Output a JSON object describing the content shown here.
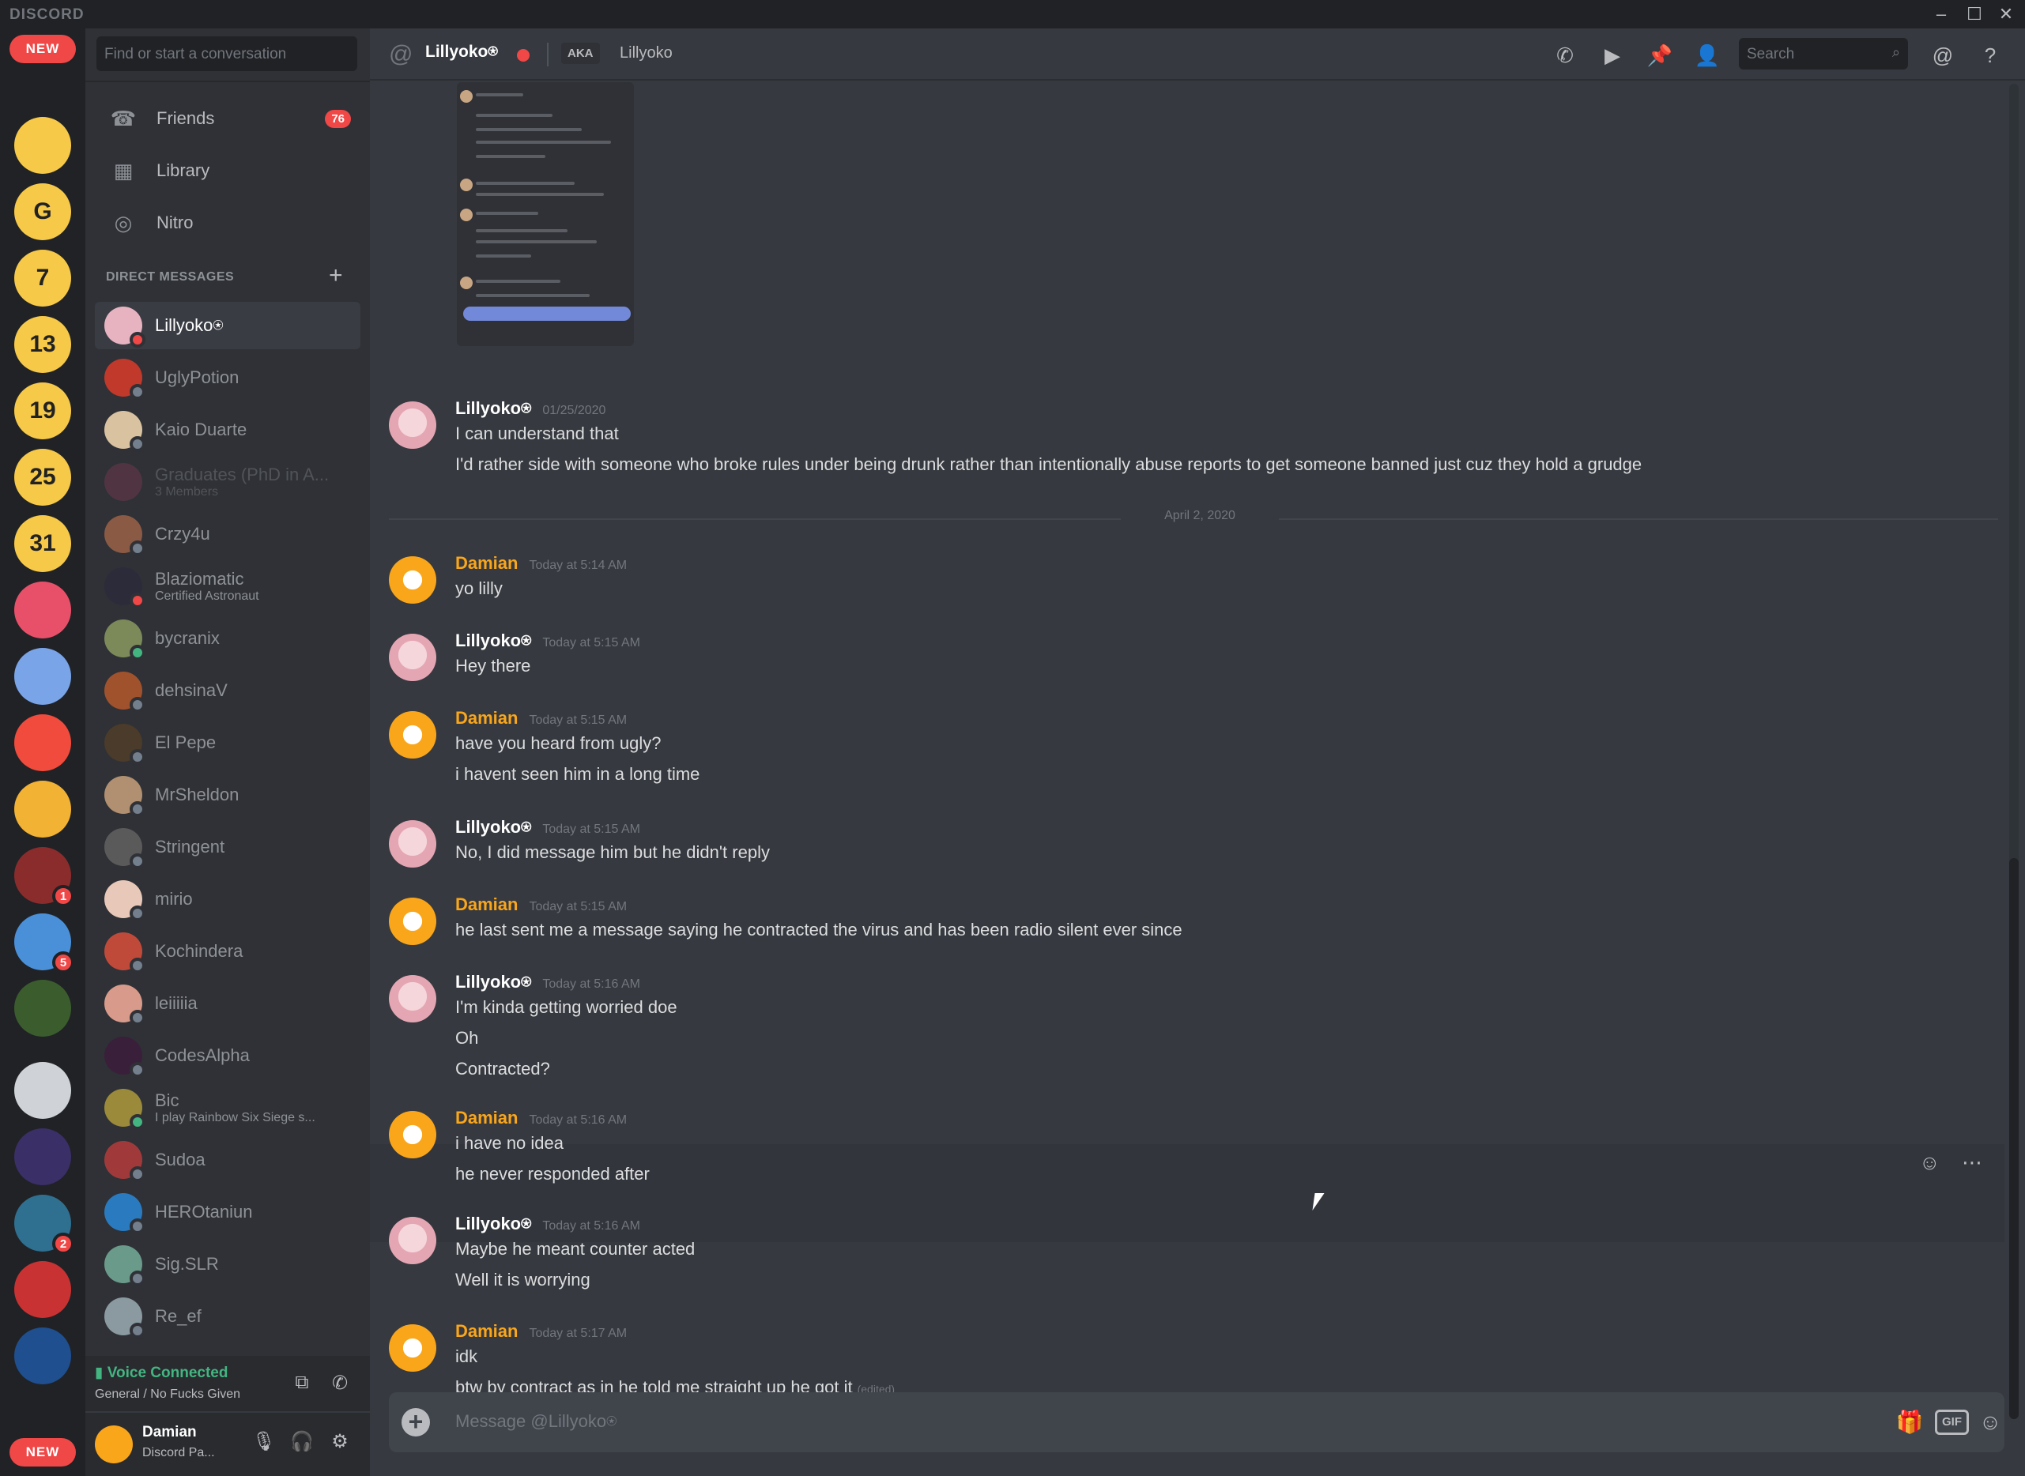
{
  "app": {
    "brand": "DISCORD",
    "window_controls": [
      "–",
      "☐",
      "✕"
    ]
  },
  "rail": {
    "new_top": "NEW",
    "new_bottom": "NEW",
    "servers": [
      {
        "label": "",
        "bg": "#f7c948",
        "badge": ""
      },
      {
        "label": "G",
        "bg": "#f7c948",
        "badge": ""
      },
      {
        "label": "7",
        "bg": "#f7c948",
        "badge": ""
      },
      {
        "label": "13",
        "bg": "#f7c948",
        "badge": ""
      },
      {
        "label": "19",
        "bg": "#f7c948",
        "badge": ""
      },
      {
        "label": "25",
        "bg": "#f7c948",
        "badge": ""
      },
      {
        "label": "31",
        "bg": "#f7c948",
        "badge": ""
      },
      {
        "label": "",
        "bg": "#e8506a",
        "badge": ""
      },
      {
        "label": "",
        "bg": "#7aa4e8",
        "badge": ""
      },
      {
        "label": "",
        "bg": "#f04b3c",
        "badge": ""
      },
      {
        "label": "",
        "bg": "#f2b233",
        "badge": ""
      },
      {
        "label": "",
        "bg": "#8a2c2c",
        "badge": "1"
      },
      {
        "label": "",
        "bg": "#4a90d9",
        "badge": "5"
      },
      {
        "label": "",
        "bg": "#3b5d2e",
        "badge": ""
      },
      {
        "label": "",
        "bg": "#cfd2d6",
        "badge": ""
      },
      {
        "label": "",
        "bg": "#3a2f66",
        "badge": ""
      },
      {
        "label": "",
        "bg": "#2f6f8f",
        "badge": "2"
      },
      {
        "label": "",
        "bg": "#c83232",
        "badge": ""
      },
      {
        "label": "",
        "bg": "#1f4f8f",
        "badge": ""
      }
    ]
  },
  "dm_panel": {
    "search_placeholder": "Find or start a conversation",
    "nav": [
      {
        "label": "Friends",
        "icon": "friends-icon",
        "count": "76"
      },
      {
        "label": "Library",
        "icon": "library-icon",
        "count": ""
      },
      {
        "label": "Nitro",
        "icon": "nitro-icon",
        "count": ""
      }
    ],
    "heading": "DIRECT MESSAGES",
    "add_symbol": "+",
    "dms": [
      {
        "name": "Lillyoko⍟",
        "sub": "",
        "status": "dnd",
        "color": "#e7b3c0",
        "active": true
      },
      {
        "name": "UglyPotion",
        "sub": "",
        "status": "mobile",
        "color": "#c0392b"
      },
      {
        "name": "Kaio Duarte",
        "sub": "",
        "status": "offline",
        "color": "#d9c2a0"
      },
      {
        "name": "Graduates (PhD in A...",
        "sub": "3 Members",
        "status": "",
        "color": "#8e3a59",
        "faded": true
      },
      {
        "name": "Crzy4u",
        "sub": "",
        "status": "offline",
        "color": "#8a5a44"
      },
      {
        "name": "Blaziomatic",
        "sub": "Certified Astronaut",
        "status": "dnd",
        "color": "#2b2b3a"
      },
      {
        "name": "bycranix",
        "sub": "",
        "status": "on",
        "color": "#7c8a5a"
      },
      {
        "name": "dehsinaV",
        "sub": "",
        "status": "offline",
        "color": "#a0522d"
      },
      {
        "name": "El Pepe",
        "sub": "",
        "status": "offline",
        "color": "#4a3b2a"
      },
      {
        "name": "MrSheldon",
        "sub": "",
        "status": "offline",
        "color": "#b09070"
      },
      {
        "name": "Stringent",
        "sub": "",
        "status": "offline",
        "color": "#5a5a5a"
      },
      {
        "name": "mirio",
        "sub": "",
        "status": "offline",
        "color": "#e8c8b8"
      },
      {
        "name": "Kochindera",
        "sub": "",
        "status": "offline",
        "color": "#c04a3a"
      },
      {
        "name": "leiiiiia",
        "sub": "",
        "status": "offline",
        "color": "#d89a8a"
      },
      {
        "name": "CodesAlpha",
        "sub": "",
        "status": "offline",
        "color": "#3a1f3a"
      },
      {
        "name": "Bic",
        "sub": "I play Rainbow Six Siege s...",
        "status": "on",
        "color": "#9a8a3a"
      },
      {
        "name": "Sudoa",
        "sub": "",
        "status": "offline",
        "color": "#a03a3a"
      },
      {
        "name": "HEROtaniun",
        "sub": "",
        "status": "offline",
        "color": "#2a7ac0"
      },
      {
        "name": "Sig.SLR",
        "sub": "",
        "status": "offline",
        "color": "#6a9a8a"
      },
      {
        "name": "Re_ef",
        "sub": "",
        "status": "offline",
        "color": "#8a9aa0"
      }
    ],
    "voice": {
      "status": "Voice Connected",
      "channel": "General / No Fucks Given"
    },
    "user": {
      "name": "Damian",
      "status": "Discord Pa..."
    }
  },
  "header": {
    "title": "Lillyoko⍟",
    "aka_tag": "AKA",
    "aka_name": "Lillyoko",
    "search_placeholder": "Search",
    "icons": [
      "call-icon",
      "video-icon",
      "pin-icon",
      "add-friend-icon",
      "mention-icon",
      "help-icon"
    ]
  },
  "chat": {
    "date_separator": "April 2, 2020",
    "messages": [
      {
        "author": "Lillyoko⍟",
        "time": "01/25/2020",
        "lines": [
          "I can understand that",
          "I'd rather side with someone who broke rules under being drunk rather than intentionally abuse reports to get someone banned just cuz they hold a grudge"
        ]
      },
      {
        "author": "Damian",
        "time": "Today at 5:14 AM",
        "lines": [
          "yo lilly"
        ]
      },
      {
        "author": "Lillyoko⍟",
        "time": "Today at 5:15 AM",
        "lines": [
          "Hey there"
        ]
      },
      {
        "author": "Damian",
        "time": "Today at 5:15 AM",
        "lines": [
          "have you heard from ugly?",
          "i havent seen him in a long time"
        ]
      },
      {
        "author": "Lillyoko⍟",
        "time": "Today at 5:15 AM",
        "lines": [
          "No, I did message him but he didn't reply"
        ]
      },
      {
        "author": "Damian",
        "time": "Today at 5:15 AM",
        "lines": [
          "he last sent me a message saying he contracted the virus and has been radio silent ever since"
        ]
      },
      {
        "author": "Lillyoko⍟",
        "time": "Today at 5:16 AM",
        "lines": [
          "I'm kinda getting worried doe",
          "Oh",
          "Contracted?"
        ]
      },
      {
        "author": "Damian",
        "time": "Today at 5:16 AM",
        "lines": [
          "i have no idea",
          "he never responded after"
        ]
      },
      {
        "author": "Lillyoko⍟",
        "time": "Today at 5:16 AM",
        "lines": [
          "Maybe he meant counter acted",
          "Well it is worrying"
        ]
      },
      {
        "author": "Damian",
        "time": "Today at 5:17 AM",
        "lines": [
          "idk",
          "btw by contract as in he told me straight up he got it"
        ],
        "edited": "(edited)"
      }
    ]
  },
  "composer": {
    "placeholder": "Message @Lillyoko⍟",
    "gif_label": "GIF"
  }
}
